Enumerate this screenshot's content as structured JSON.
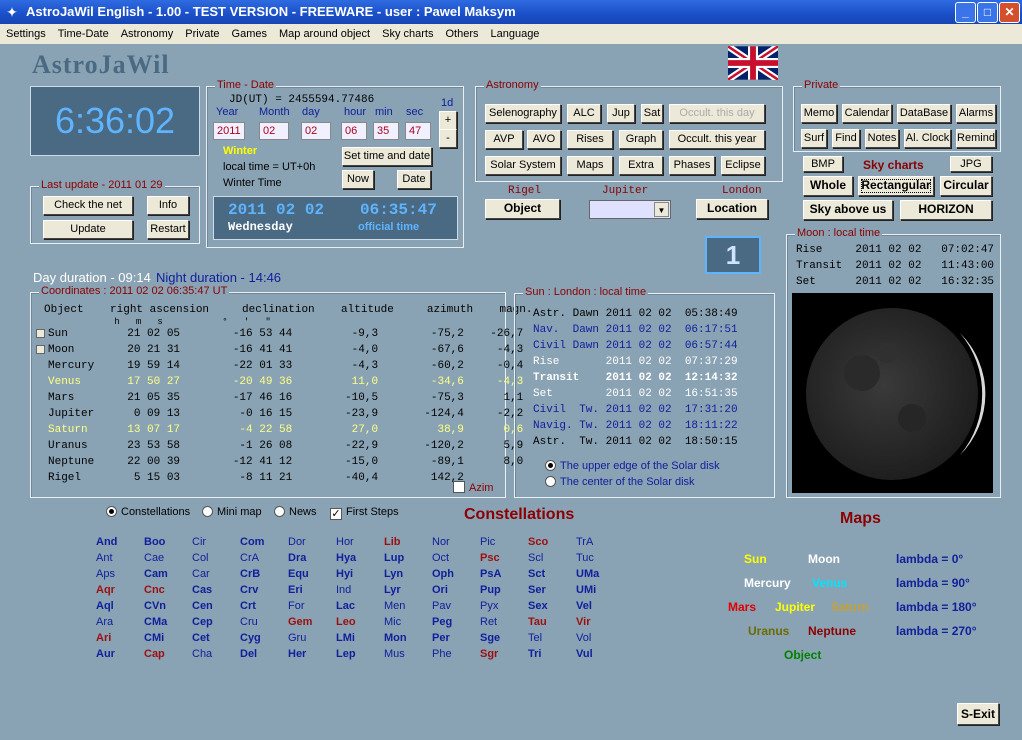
{
  "window": {
    "title": "AstroJaWil English -   1.00 - TEST VERSION - FREEWARE - user :  Pawel Maksym"
  },
  "menu": [
    "Settings",
    "Time-Date",
    "Astronomy",
    "Private",
    "Games",
    "Map around object",
    "Sky charts",
    "Others",
    "Language"
  ],
  "logo": "AstroJaWil",
  "clock": "6:36:02",
  "time_date": {
    "legend": "Time - Date",
    "jd": "JD(UT) = 2455594.77486",
    "labels": [
      "Year",
      "Month",
      "day",
      "hour",
      "min",
      "sec"
    ],
    "values": [
      "2011",
      "02",
      "02",
      "06",
      "35",
      "47"
    ],
    "step_label": "1d",
    "plus": "+",
    "minus": "-",
    "season": "Winter",
    "local_time": "local time = UT+0h",
    "winter_time": "Winter Time",
    "set_btn": "Set time and date",
    "now_btn": "Now",
    "date_btn": "Date",
    "display_date": "2011 02 02",
    "display_time": "06:35:47",
    "display_day": "Wednesday",
    "display_note": "official time"
  },
  "last_update": {
    "legend": "Last update - 2011 01 29",
    "check": "Check the net",
    "info": "Info",
    "update": "Update",
    "restart": "Restart"
  },
  "astronomy": {
    "legend": "Astronomy",
    "row1": [
      "Selenography",
      "ALC",
      "Jup",
      "Sat",
      "Occult. this day"
    ],
    "row2": [
      "AVP",
      "AVO",
      "Rises",
      "Graph",
      "Occult. this year"
    ],
    "row3": [
      "Solar System",
      "Maps",
      "Extra",
      "Phases",
      "Eclipse"
    ]
  },
  "object_sel": {
    "rigel": "Rigel",
    "jupiter": "Jupiter",
    "london": "London",
    "object_btn": "Object",
    "location_btn": "Location"
  },
  "private": {
    "legend": "Private",
    "row1": [
      "Memo",
      "Calendar",
      "DataBase",
      "Alarms"
    ],
    "row2": [
      "Surf",
      "Find",
      "Notes",
      "Al. Clock",
      "Remind"
    ]
  },
  "sky": {
    "bmp": "BMP",
    "label": "Sky charts",
    "jpg": "JPG",
    "whole": "Whole",
    "rect": "Rectangular",
    "circ": "Circular",
    "above": "Sky above us",
    "horizon": "HORIZON"
  },
  "badge": "1",
  "duration": {
    "day": "Day duration - 09:14",
    "night": "Night duration - 14:46"
  },
  "coords": {
    "legend": "Coordinates : 2011 02 02  06:35:47 UT",
    "header": "Object    right ascension     declination    altitude     azimuth    magn.",
    "units": "             h   m   s           °   '   \"",
    "rows": [
      {
        "t": "Sun         21 02 05        -16 53 44         -9,3        -75,2    -26,7",
        "c": "#000"
      },
      {
        "t": "Moon        20 21 31        -16 41 41         -4,0        -67,6     -4,3",
        "c": "#000"
      },
      {
        "t": "Mercury     19 59 14        -22 01 33         -4,3        -60,2     -0,4",
        "c": "#000"
      },
      {
        "t": "Venus       17 50 27        -20 49 36         11,0        -34,6     -4,3",
        "c": "#ffff80"
      },
      {
        "t": "Mars        21 05 35        -17 46 16        -10,5        -75,3      1,1",
        "c": "#000"
      },
      {
        "t": "Jupiter      0 09 13         -0 16 15        -23,9       -124,4     -2,2",
        "c": "#000"
      },
      {
        "t": "Saturn      13 07 17         -4 22 58         27,0         38,9      0,6",
        "c": "#ffff80"
      },
      {
        "t": "Uranus      23 53 58         -1 26 08        -22,9       -120,2      5,9",
        "c": "#000"
      },
      {
        "t": "Neptune     22 00 39        -12 41 12        -15,0        -89,1      8,0",
        "c": "#000"
      },
      {
        "t": "Rigel        5 15 03         -8 11 21        -40,4        142,2",
        "c": "#000"
      }
    ],
    "azim": "Azim"
  },
  "sun": {
    "legend": "Sun : London : local time",
    "rows": [
      {
        "t": "Astr. Dawn 2011 02 02  05:38:49",
        "c": "#000",
        "w": "normal"
      },
      {
        "t": "Nav.  Dawn 2011 02 02  06:17:51",
        "c": "#10209a",
        "w": "normal"
      },
      {
        "t": "Civil Dawn 2011 02 02  06:57:44",
        "c": "#10209a",
        "w": "normal"
      },
      {
        "t": "Rise       2011 02 02  07:37:29",
        "c": "#fff",
        "w": "normal"
      },
      {
        "t": "Transit    2011 02 02  12:14:32",
        "c": "#fff",
        "w": "bold"
      },
      {
        "t": "Set        2011 02 02  16:51:35",
        "c": "#fff",
        "w": "normal"
      },
      {
        "t": "Civil  Tw. 2011 02 02  17:31:20",
        "c": "#10209a",
        "w": "normal"
      },
      {
        "t": "Navig. Tw. 2011 02 02  18:11:22",
        "c": "#10209a",
        "w": "normal"
      },
      {
        "t": "Astr.  Tw. 2011 02 02  18:50:15",
        "c": "#000",
        "w": "normal"
      }
    ],
    "opt1": "The upper edge of the Solar disk",
    "opt2": "The center of the Solar disk"
  },
  "moon": {
    "legend": "Moon : local time",
    "rows": [
      "Rise     2011 02 02   07:02:47",
      "Transit  2011 02 02   11:43:00",
      "Set      2011 02 02   16:32:35"
    ]
  },
  "options": {
    "constellations": "Constellations",
    "minimap": "Mini map",
    "news": "News",
    "first": "First Steps"
  },
  "constellations": {
    "title": "Constellations",
    "cols": [
      [
        "And",
        "Ant",
        "Aps",
        "Aqr",
        "Aql",
        "Ara",
        "Ari",
        "Aur"
      ],
      [
        "Boo",
        "Cae",
        "Cam",
        "Cnc",
        "CVn",
        "CMa",
        "CMi",
        "Cap"
      ],
      [
        "Cir",
        "Col",
        "Car",
        "Cas",
        "Cen",
        "Cep",
        "Cet",
        "Cha"
      ],
      [
        "Com",
        "CrA",
        "CrB",
        "Crv",
        "Crt",
        "Cru",
        "Cyg",
        "Del"
      ],
      [
        "Dor",
        "Dra",
        "Equ",
        "Eri",
        "For",
        "Gem",
        "Gru",
        "Her"
      ],
      [
        "Hor",
        "Hya",
        "Hyi",
        "Ind",
        "Lac",
        "Leo",
        "LMi",
        "Lep"
      ],
      [
        "Lib",
        "Lup",
        "Lyn",
        "Lyr",
        "Men",
        "Mic",
        "Mon",
        "Mus"
      ],
      [
        "Nor",
        "Oct",
        "Oph",
        "Ori",
        "Pav",
        "Peg",
        "Per",
        "Phe"
      ],
      [
        "Pic",
        "Psc",
        "PsA",
        "Pup",
        "Pyx",
        "Ret",
        "Sge",
        "Sgr"
      ],
      [
        "Sco",
        "Scl",
        "Sct",
        "Ser",
        "Sex",
        "Tau",
        "Tel",
        "Tri"
      ],
      [
        "TrA",
        "Tuc",
        "UMa",
        "UMi",
        "Vel",
        "Vir",
        "Vol",
        "Vul"
      ]
    ],
    "styles": [
      [
        "b",
        "n",
        "n",
        "r",
        "b",
        "n",
        "r",
        "b"
      ],
      [
        "b",
        "n",
        "b",
        "r",
        "b",
        "b",
        "b",
        "r"
      ],
      [
        "n",
        "n",
        "n",
        "b",
        "b",
        "b",
        "b",
        "n"
      ],
      [
        "b",
        "n",
        "b",
        "b",
        "b",
        "n",
        "b",
        "b"
      ],
      [
        "n",
        "b",
        "b",
        "b",
        "n",
        "r",
        "n",
        "b"
      ],
      [
        "n",
        "b",
        "b",
        "n",
        "b",
        "r",
        "b",
        "b"
      ],
      [
        "r",
        "b",
        "b",
        "b",
        "n",
        "n",
        "b",
        "n"
      ],
      [
        "n",
        "n",
        "b",
        "b",
        "n",
        "b",
        "b",
        "n"
      ],
      [
        "n",
        "r",
        "b",
        "b",
        "n",
        "n",
        "b",
        "r"
      ],
      [
        "r",
        "n",
        "b",
        "b",
        "b",
        "r",
        "n",
        "b"
      ],
      [
        "n",
        "n",
        "b",
        "b",
        "b",
        "r",
        "n",
        "b"
      ]
    ]
  },
  "maps": {
    "title": "Maps",
    "items": [
      {
        "t": "Sun",
        "c": "#ffff00"
      },
      {
        "t": "Moon",
        "c": "#ffffff"
      },
      {
        "t": "lambda =   0°",
        "c": "#10209a"
      },
      {
        "t": "Mercury",
        "c": "#ffffff"
      },
      {
        "t": "Venus",
        "c": "#00e5ff"
      },
      {
        "t": "lambda =  90°",
        "c": "#10209a"
      },
      {
        "t": "Mars",
        "c": "#e00000"
      },
      {
        "t": "Jupiter",
        "c": "#ffff00"
      },
      {
        "t": "Saturn",
        "c": "#c8a030"
      },
      {
        "t": "lambda = 180°",
        "c": "#10209a"
      },
      {
        "t": "Uranus",
        "c": "#6b6b00"
      },
      {
        "t": "Neptune",
        "c": "#8b0000"
      },
      {
        "t": "lambda = 270°",
        "c": "#10209a"
      },
      {
        "t": "Object",
        "c": "#008000"
      }
    ]
  },
  "exit": "S-Exit"
}
